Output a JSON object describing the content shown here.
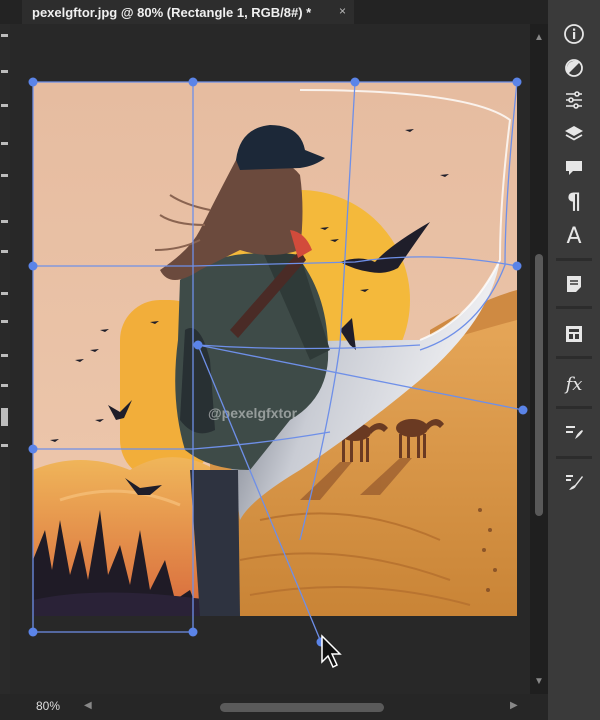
{
  "document": {
    "tab_title": "pexelgftor.jpg @ 80% (Rectangle 1, RGB/8#) *",
    "close_glyph": "×"
  },
  "status": {
    "zoom": "80%"
  },
  "watermark": "@pexelgfxtor",
  "right_panel": {
    "icons": [
      "info-icon",
      "adjustments-icon",
      "properties-sliders-icon",
      "layers-icon",
      "comments-icon",
      "paragraph-icon",
      "character-icon",
      "notes-icon",
      "libraries-icon",
      "fx-styles-icon",
      "brush-settings-icon",
      "brushes-icon"
    ],
    "character_glyph": "A",
    "paragraph_glyph": "¶",
    "fx_glyph": "fx"
  },
  "colors": {
    "ui_dark": "#1e1e1e",
    "panel": "#3a3a3a",
    "canvas": "#282828",
    "selection_blue": "#5b84e8",
    "sky_peach": "#e9c0a4",
    "sun": "#f3b63a",
    "sand": "#d99646"
  }
}
